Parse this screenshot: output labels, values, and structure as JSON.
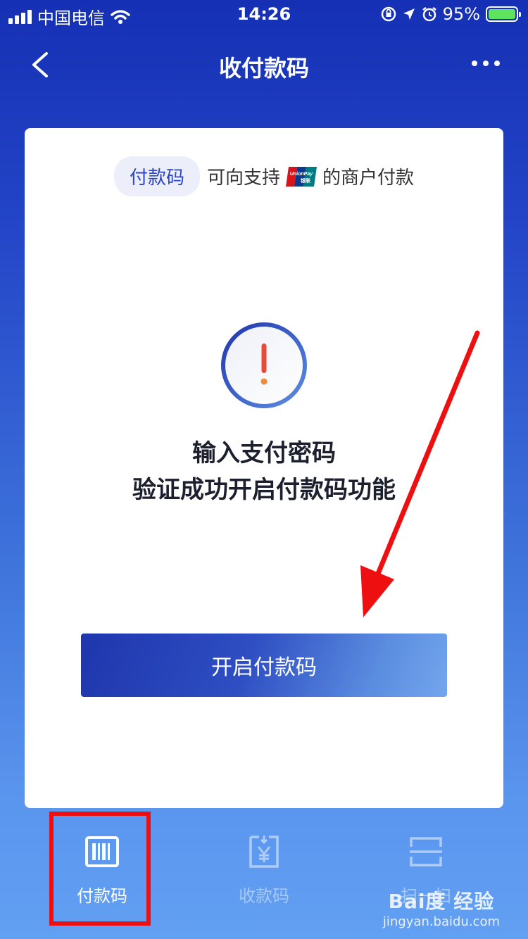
{
  "status_bar": {
    "carrier": "中国电信",
    "time": "14:26",
    "battery": "95%"
  },
  "nav": {
    "title": "收付款码"
  },
  "card": {
    "pill_label": "付款码",
    "support_prefix": "可向支持",
    "support_suffix": "的商户付款",
    "logo_label": "UnionPay 银联",
    "message_line1": "输入支付密码",
    "message_line2": "验证成功开启付款码功能",
    "button_label": "开启付款码"
  },
  "tabs": [
    {
      "label": "付款码",
      "icon": "barcode-icon",
      "active": true
    },
    {
      "label": "收款码",
      "icon": "yuan-receipt-icon",
      "active": false
    },
    {
      "label": "扫一扫",
      "icon": "scan-icon",
      "active": false
    }
  ],
  "watermark": {
    "brand": "Bai度 经验",
    "url": "jingyan.baidu.com"
  },
  "colors": {
    "accent": "#2b45c9",
    "warning_red": "#e84a3a",
    "annotation_red": "#ee1010"
  }
}
